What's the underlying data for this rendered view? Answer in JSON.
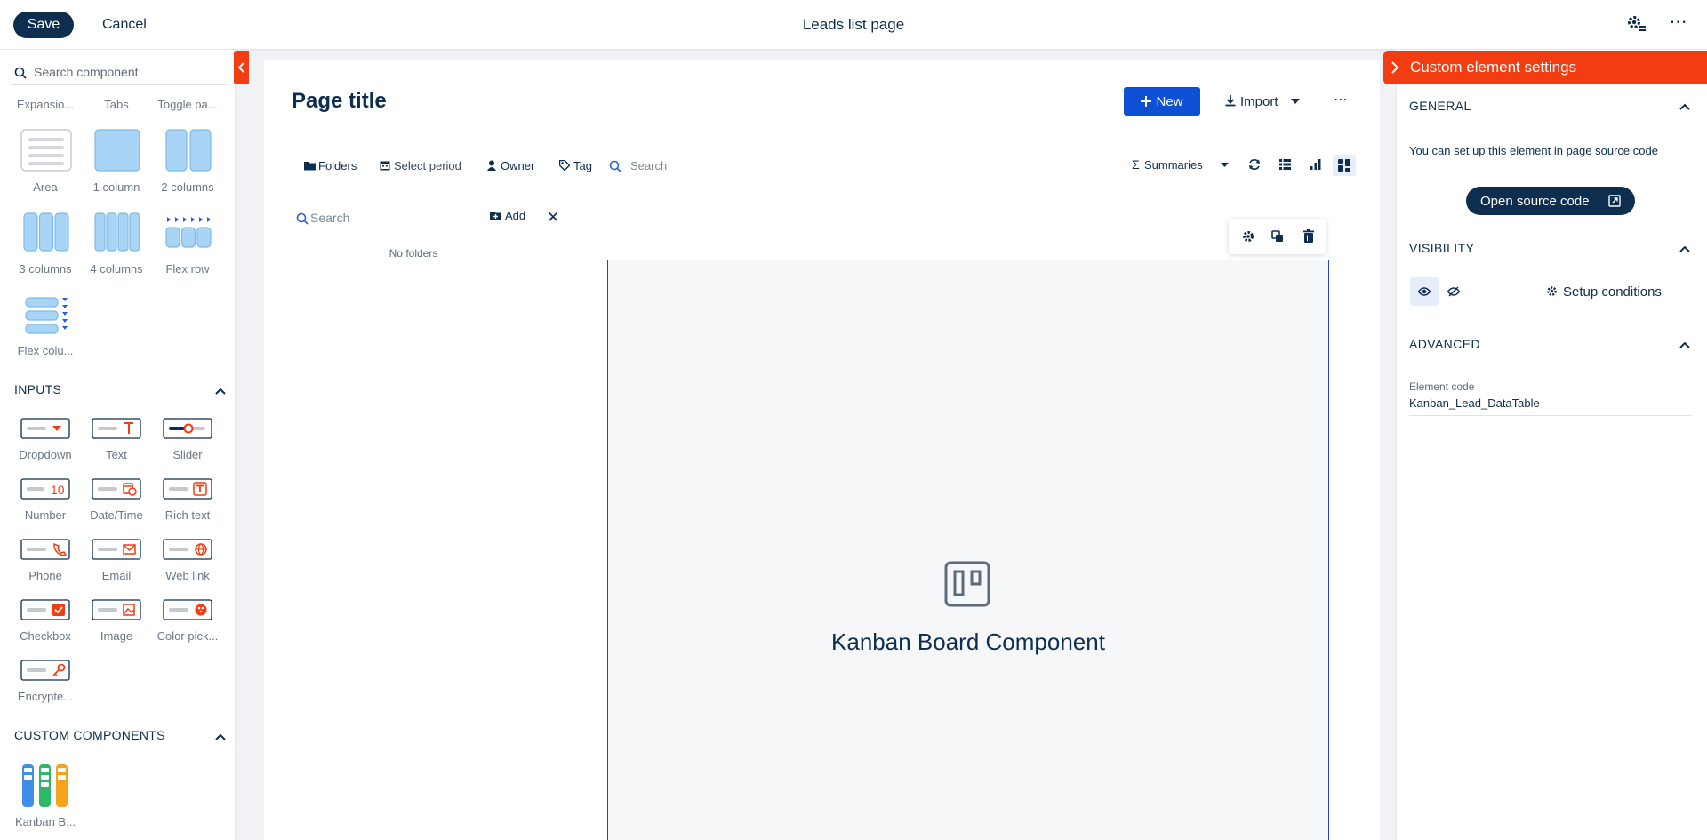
{
  "topbar": {
    "save_label": "Save",
    "cancel_label": "Cancel",
    "page_name": "Leads list page",
    "more_label": "⋯"
  },
  "left_panel": {
    "search_placeholder": "Search component",
    "layout_tabs": [
      "Expansio...",
      "Tabs",
      "Toggle pa..."
    ],
    "layout_items": [
      "Area",
      "1 column",
      "2 columns",
      "3 columns",
      "4 columns",
      "Flex row",
      "Flex colu..."
    ],
    "inputs_title": "INPUTS",
    "input_items": [
      "Dropdown",
      "Text",
      "Slider",
      "Number",
      "Date/Time",
      "Rich text",
      "Phone",
      "Email",
      "Web link",
      "Checkbox",
      "Image",
      "Color pick...",
      "Encrypte..."
    ],
    "number_glyph": "10",
    "custom_title": "CUSTOM COMPONENTS",
    "custom_items": [
      "Kanban B..."
    ]
  },
  "canvas": {
    "page_title": "Page title",
    "new_label": "New",
    "import_label": "Import",
    "more_label": "⋯",
    "filters": {
      "folders": "Folders",
      "select_period": "Select period",
      "owner": "Owner",
      "tag": "Tag",
      "search_placeholder": "Search"
    },
    "summaries_label": "Summaries",
    "folders_panel": {
      "search_placeholder": "Search",
      "add_label": "Add",
      "close_label": "✕",
      "empty_text": "No folders"
    },
    "kanban_label": "Kanban Board Component"
  },
  "right_panel": {
    "title": "Custom element settings",
    "general_title": "GENERAL",
    "general_text": "You can set up this element in page source code",
    "open_source_label": "Open source code",
    "visibility_title": "VISIBILITY",
    "setup_conditions_label": "Setup conditions",
    "advanced_title": "ADVANCED",
    "element_code_label": "Element code",
    "element_code_value": "Kanban_Lead_DataTable"
  },
  "colors": {
    "navy": "#0d2e4e",
    "accent_orange": "#f23c12",
    "primary_blue": "#0d50d6",
    "selection_blue": "#2144c7"
  }
}
